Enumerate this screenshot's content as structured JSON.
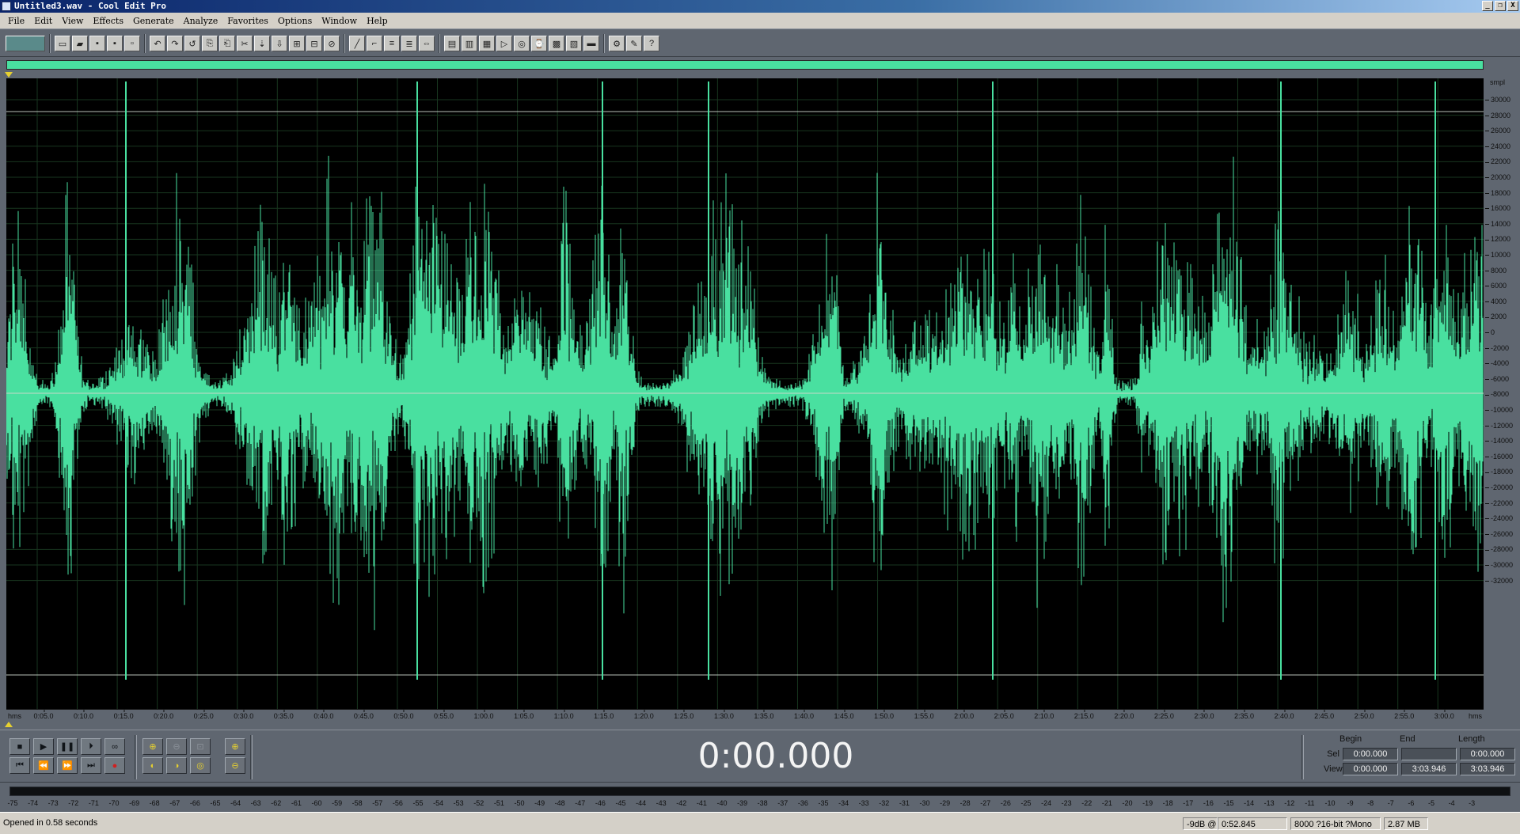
{
  "window": {
    "title": "Untitled3.wav - Cool Edit Pro",
    "minimize": "_",
    "restore": "❐",
    "close": "X"
  },
  "menu": [
    "File",
    "Edit",
    "View",
    "Effects",
    "Generate",
    "Analyze",
    "Favorites",
    "Options",
    "Window",
    "Help"
  ],
  "waveform": {
    "color": "#49e0a0",
    "background": "#000000",
    "unit": "smpl",
    "amplitude_ticks": [
      "30000",
      "28000",
      "26000",
      "24000",
      "22000",
      "20000",
      "18000",
      "16000",
      "14000",
      "12000",
      "10000",
      "8000",
      "6000",
      "4000",
      "2000",
      "0",
      "-2000",
      "-4000",
      "-6000",
      "-8000",
      "-10000",
      "-12000",
      "-14000",
      "-16000",
      "-18000",
      "-20000",
      "-22000",
      "-24000",
      "-26000",
      "-28000",
      "-30000",
      "-32000"
    ]
  },
  "time_ruler": {
    "unit": "hms",
    "ticks": [
      "0:05.0",
      "0:10.0",
      "0:15.0",
      "0:20.0",
      "0:25.0",
      "0:30.0",
      "0:35.0",
      "0:40.0",
      "0:45.0",
      "0:50.0",
      "0:55.0",
      "1:00.0",
      "1:05.0",
      "1:10.0",
      "1:15.0",
      "1:20.0",
      "1:25.0",
      "1:30.0",
      "1:35.0",
      "1:40.0",
      "1:45.0",
      "1:50.0",
      "1:55.0",
      "2:00.0",
      "2:05.0",
      "2:10.0",
      "2:15.0",
      "2:20.0",
      "2:25.0",
      "2:30.0",
      "2:35.0",
      "2:40.0",
      "2:45.0",
      "2:50.0",
      "2:55.0",
      "3:00.0"
    ]
  },
  "transport": {
    "row1": [
      "■",
      "▶",
      "❚❚",
      "⏵",
      "∞"
    ],
    "row2": [
      "⏮",
      "⏪",
      "⏩",
      "⏭",
      "●"
    ]
  },
  "current_time": "0:00.000",
  "selection": {
    "headers": {
      "begin": "Begin",
      "end": "End",
      "length": "Length"
    },
    "sel": {
      "label": "Sel",
      "begin": "0:00.000",
      "end": "",
      "length": "0:00.000"
    },
    "view": {
      "label": "View",
      "begin": "0:00.000",
      "end": "3:03.946",
      "length": "3:03.946"
    }
  },
  "level_meter": {
    "db_ticks": [
      "-75",
      "-74",
      "-73",
      "-72",
      "-71",
      "-70",
      "-69",
      "-68",
      "-67",
      "-66",
      "-65",
      "-64",
      "-63",
      "-62",
      "-61",
      "-60",
      "-59",
      "-58",
      "-57",
      "-56",
      "-55",
      "-54",
      "-53",
      "-52",
      "-51",
      "-50",
      "-49",
      "-48",
      "-47",
      "-46",
      "-45",
      "-44",
      "-43",
      "-42",
      "-41",
      "-40",
      "-39",
      "-38",
      "-37",
      "-36",
      "-35",
      "-34",
      "-33",
      "-32",
      "-31",
      "-30",
      "-29",
      "-28",
      "-27",
      "-26",
      "-25",
      "-24",
      "-23",
      "-22",
      "-21",
      "-20",
      "-19",
      "-18",
      "-17",
      "-16",
      "-15",
      "-14",
      "-13",
      "-12",
      "-11",
      "-10",
      "-9",
      "-8",
      "-7",
      "-6",
      "-5",
      "-4",
      "-3"
    ]
  },
  "status": {
    "message": "Opened in 0.58 seconds",
    "cursor_level": "-9dB @",
    "cursor_time": "0:52.845",
    "format": "8000 ?16-bit ?Mono",
    "file_size": "2.87 MB"
  }
}
